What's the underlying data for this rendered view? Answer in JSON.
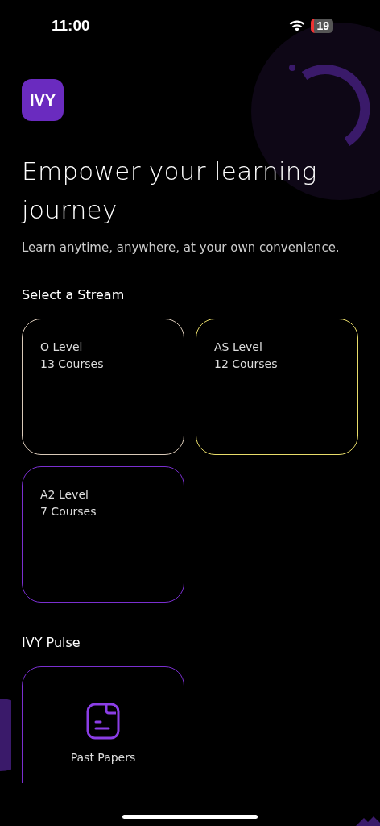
{
  "status_bar": {
    "time": "11:00",
    "battery": "19"
  },
  "logo": {
    "text": "IVY"
  },
  "heading": "Empower your learning journey",
  "subheading": "Learn anytime, anywhere, at your own convenience.",
  "streams": {
    "title": "Select a Stream",
    "items": [
      {
        "name": "O Level",
        "courses": "13 Courses",
        "color": "#d9c9b8"
      },
      {
        "name": "AS Level",
        "courses": "12 Courses",
        "color": "#e8dc6a"
      },
      {
        "name": "A2 Level",
        "courses": "7 Courses",
        "color": "#7a2fd0"
      }
    ]
  },
  "pulse": {
    "title": "IVY Pulse",
    "items": [
      {
        "label": "Past Papers"
      }
    ]
  }
}
